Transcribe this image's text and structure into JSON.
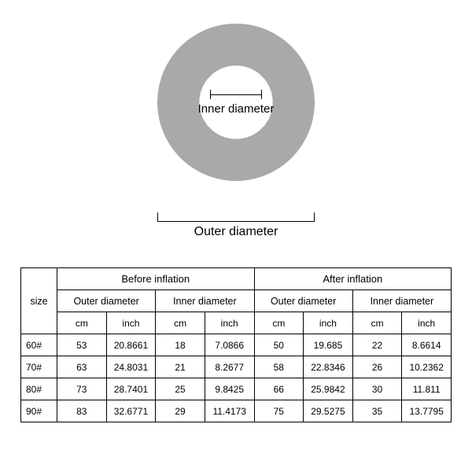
{
  "diagram": {
    "inner_label": "Inner diameter",
    "outer_label": "Outer diameter"
  },
  "table": {
    "size_label": "size",
    "groups": [
      "Before inflation",
      "After inflation"
    ],
    "subgroups": [
      "Outer diameter",
      "Inner diameter",
      "Outer diameter",
      "Inner diameter"
    ],
    "units": [
      "cm",
      "inch",
      "cm",
      "inch",
      "cm",
      "inch",
      "cm",
      "inch"
    ],
    "rows": [
      {
        "size": "60#",
        "v": [
          "53",
          "20.8661",
          "18",
          "7.0866",
          "50",
          "19.685",
          "22",
          "8.6614"
        ]
      },
      {
        "size": "70#",
        "v": [
          "63",
          "24.8031",
          "21",
          "8.2677",
          "58",
          "22.8346",
          "26",
          "10.2362"
        ]
      },
      {
        "size": "80#",
        "v": [
          "73",
          "28.7401",
          "25",
          "9.8425",
          "66",
          "25.9842",
          "30",
          "11.811"
        ]
      },
      {
        "size": "90#",
        "v": [
          "83",
          "32.6771",
          "29",
          "11.4173",
          "75",
          "29.5275",
          "35",
          "13.7795"
        ]
      }
    ]
  }
}
